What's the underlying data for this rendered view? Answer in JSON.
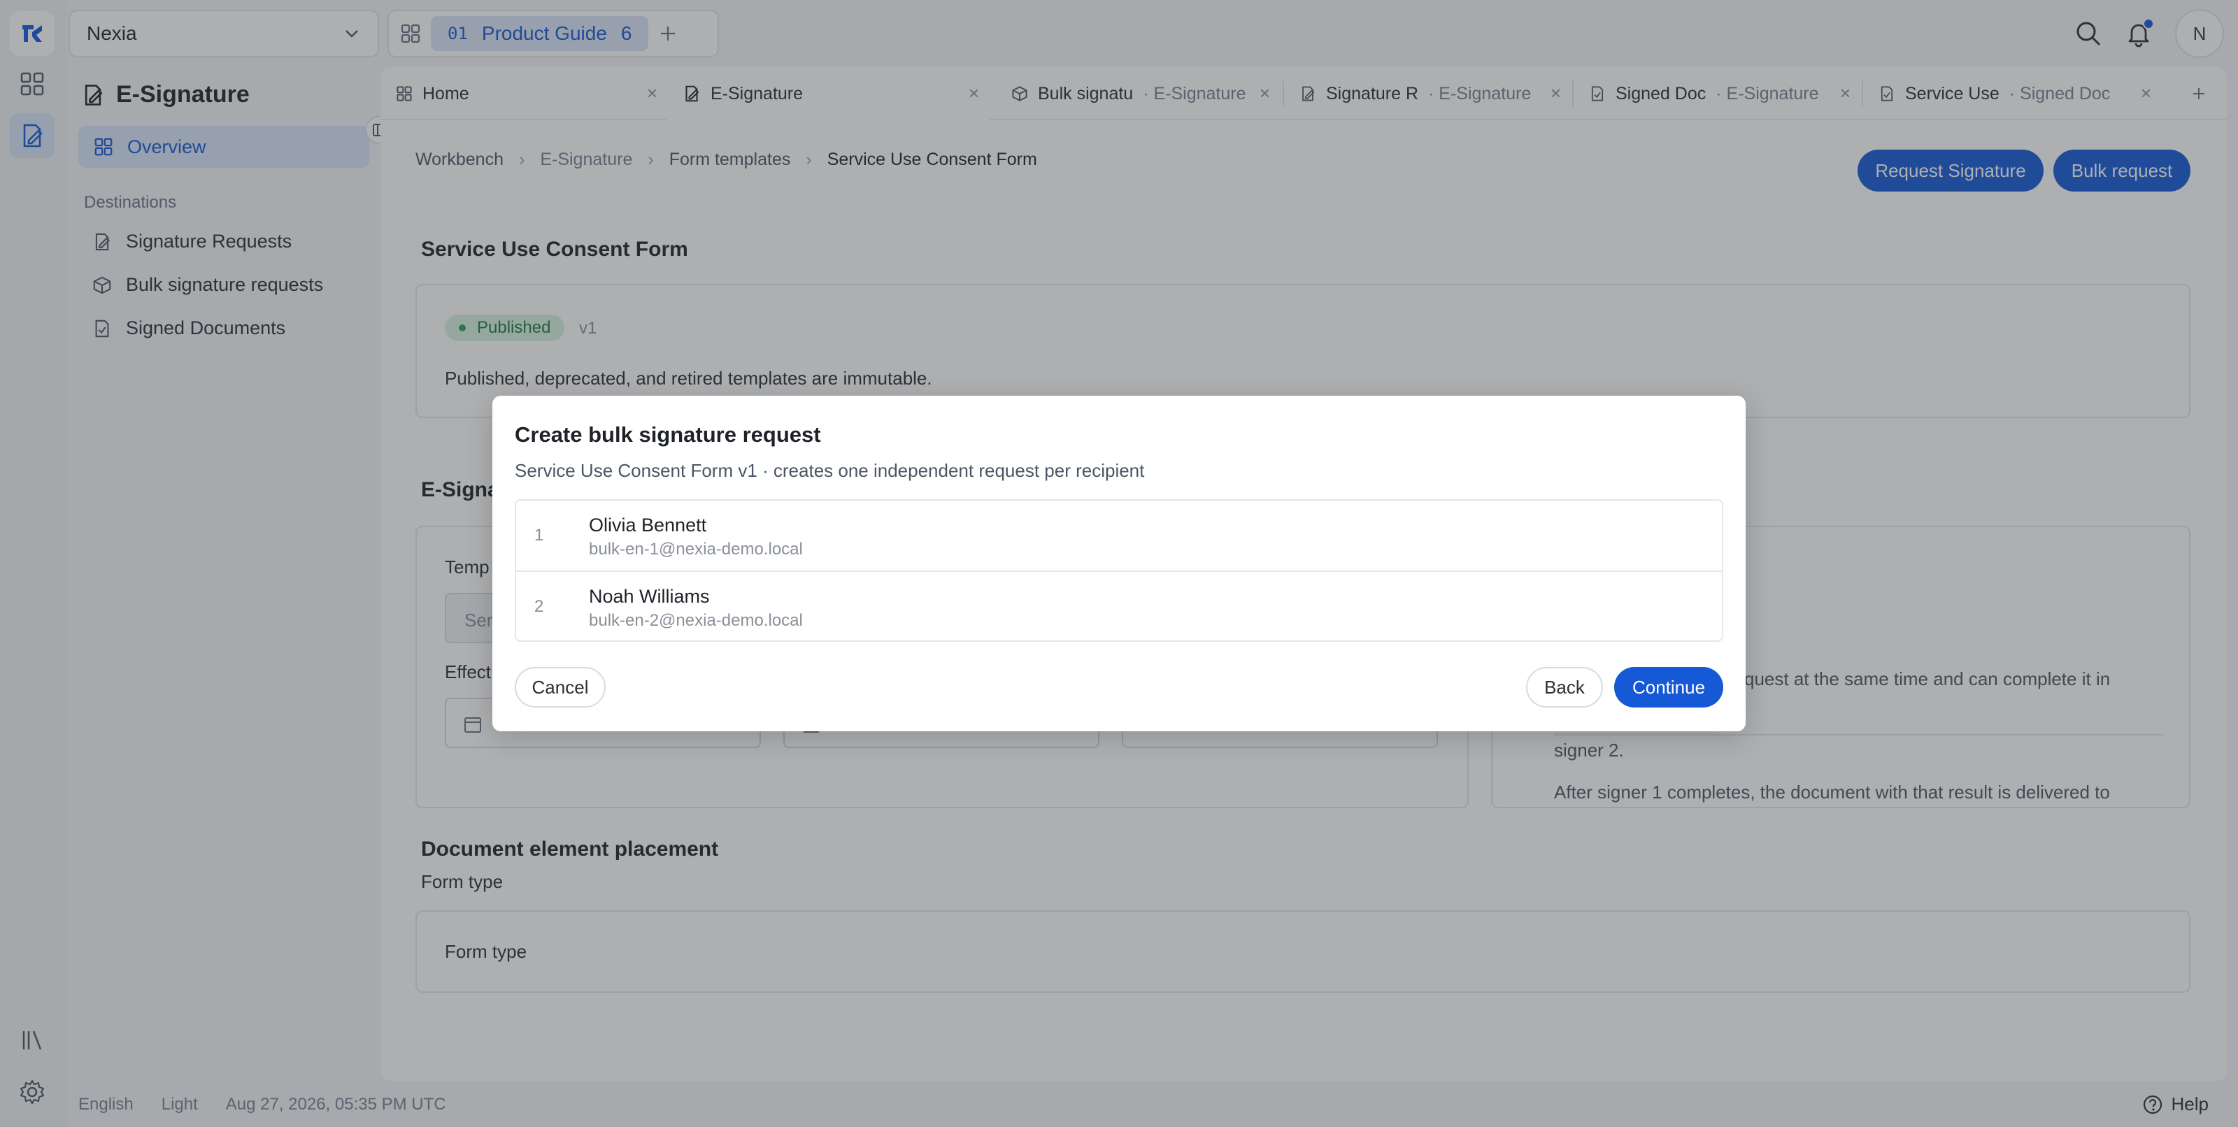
{
  "workspace": {
    "name": "Nexia"
  },
  "guide": {
    "code": "01",
    "label": "Product Guide",
    "count": "6"
  },
  "user": {
    "initial": "N"
  },
  "sidebar": {
    "title": "E-Signature",
    "overview": "Overview",
    "section": "Destinations",
    "items": [
      {
        "label": "Signature Requests",
        "icon": "signature-doc-icon"
      },
      {
        "label": "Bulk signature requests",
        "icon": "cube-icon"
      },
      {
        "label": "Signed Documents",
        "icon": "signed-doc-icon"
      }
    ]
  },
  "tabs": [
    {
      "label": "Home",
      "sub": ""
    },
    {
      "label": "E-Signature",
      "sub": ""
    },
    {
      "label": "Bulk signatu",
      "sub": "· E-Signature"
    },
    {
      "label": "Signature R",
      "sub": "· E-Signature"
    },
    {
      "label": "Signed Doc",
      "sub": "· E-Signature"
    },
    {
      "label": "Service Use",
      "sub": "· Signed Doc"
    }
  ],
  "breadcrumb": [
    "Workbench",
    "E-Signature",
    "Form templates",
    "Service Use Consent Form"
  ],
  "actions": {
    "request_signature": "Request Signature",
    "bulk_request": "Bulk request"
  },
  "template": {
    "title": "Service Use Consent Form",
    "status": "Published",
    "version": "v1",
    "note": "Published, deprecated, and retired templates are immutable."
  },
  "esig_section": {
    "title_partial": "E-Signa",
    "template_label_partial": "Temp",
    "template_value_partial": "Ser",
    "effective_label_partial": "Effect",
    "right_text_1": "quest at the same time and can complete it in",
    "right_text_2": "After signer 1 completes, the document with that result is delivered to",
    "right_text_3": "signer 2."
  },
  "placement": {
    "title": "Document element placement",
    "subtitle": "Form type",
    "card_label": "Form type"
  },
  "modal": {
    "title": "Create bulk signature request",
    "subtitle": "Service Use Consent Form v1 · creates one independent request per recipient",
    "recipients": [
      {
        "index": "1",
        "name": "Olivia Bennett",
        "email": "bulk-en-1@nexia-demo.local"
      },
      {
        "index": "2",
        "name": "Noah Williams",
        "email": "bulk-en-2@nexia-demo.local"
      }
    ],
    "cancel": "Cancel",
    "back": "Back",
    "continue": "Continue"
  },
  "footer": {
    "language": "English",
    "theme": "Light",
    "timestamp": "Aug 27, 2026, 05:35 PM UTC",
    "help": "Help"
  },
  "colors": {
    "accent": "#1559d6",
    "published_bg": "#d8f2e0",
    "published_fg": "#1d7a3e"
  }
}
